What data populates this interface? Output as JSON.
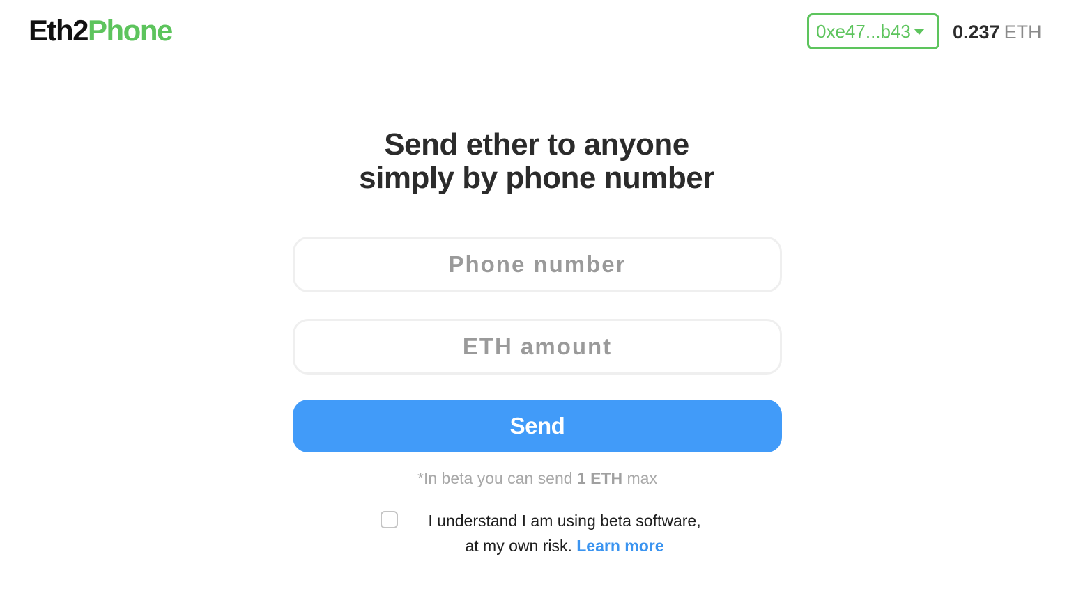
{
  "header": {
    "logo_part1": "Eth2",
    "logo_part2": "Phone",
    "wallet_address": "0xe47...b43",
    "balance_value": "0.237",
    "balance_unit": "ETH"
  },
  "main": {
    "headline_line1": "Send ether to anyone",
    "headline_line2": "simply by phone number",
    "phone_placeholder": "Phone number",
    "phone_value": "",
    "amount_placeholder": "ETH amount",
    "amount_value": "",
    "send_label": "Send",
    "beta_note_prefix": "*In beta you can send ",
    "beta_note_bold": "1 ETH",
    "beta_note_suffix": " max",
    "checkbox_checked": false,
    "consent_line1": "I understand I am using beta software,",
    "consent_line2": "at my own risk. ",
    "learn_more_label": "Learn more"
  },
  "colors": {
    "accent_green": "#5dc45d",
    "button_blue": "#419bf9",
    "link_blue": "#3b94f0"
  },
  "icons": {
    "wallet_dropdown": "caret-down-icon"
  }
}
